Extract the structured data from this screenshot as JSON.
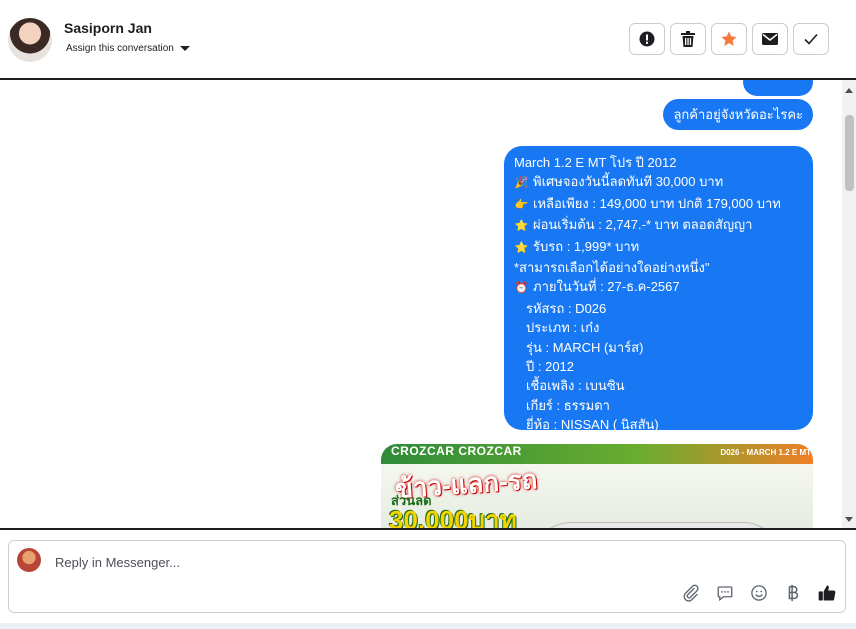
{
  "header": {
    "contact_name": "Sasiporn Jan",
    "assign_label": "Assign this conversation",
    "actions": [
      {
        "icon": "alert-icon",
        "name": "mark-spam-button"
      },
      {
        "icon": "trash-icon",
        "name": "delete-button"
      },
      {
        "icon": "star-icon",
        "name": "star-button"
      },
      {
        "icon": "envelope-icon",
        "name": "mark-unread-button"
      },
      {
        "icon": "check-icon",
        "name": "mark-done-button"
      }
    ]
  },
  "messages": {
    "partial_bubble_text": "",
    "question": "ลูกค้าอยู่จังหวัดอะไรคะ",
    "offer": {
      "title": "March 1.2 E MT โปร ปี 2012",
      "l1": "พิเศษจองวันนี้ลดทันที 30,000 บาท",
      "l2": "เหลือเพียง : 149,000 บาท ปกติ 179,000 บาท",
      "l3": "ผ่อนเริ่มต้น : 2,747.-* บาท ตลอดสัญญา",
      "l4": "รับรถ : 1,999* บาท",
      "l5": "*สามารถเลือกได้อย่างใดอย่างหนึ่ง\"",
      "l6": "ภายในวันที่ : 27-ธ.ค-2567",
      "l7": "รหัสรถ : D026",
      "l8": "ประเภท : เก๋ง",
      "l9": "รุ่น : MARCH (มาร์ส)",
      "l10": "ปี : 2012",
      "l11": "เชื้อเพลิง : เบนซิน",
      "l12": "เกียร์ : ธรรมดา",
      "l13": "ยี่ห้อ : NISSAN ( นิสสัน)"
    },
    "image_card": {
      "brand": "CROZCAR CROZCAR",
      "tag": "D026 - MARCH 1.2 E MT",
      "headline": "ข้าว-แลก-รถ",
      "sub": "ส่วนลด",
      "amount": "30,000บาท"
    }
  },
  "composer": {
    "placeholder": "Reply in Messenger..."
  },
  "colors": {
    "bubble": "#1877f2",
    "star": "#f5793b"
  }
}
